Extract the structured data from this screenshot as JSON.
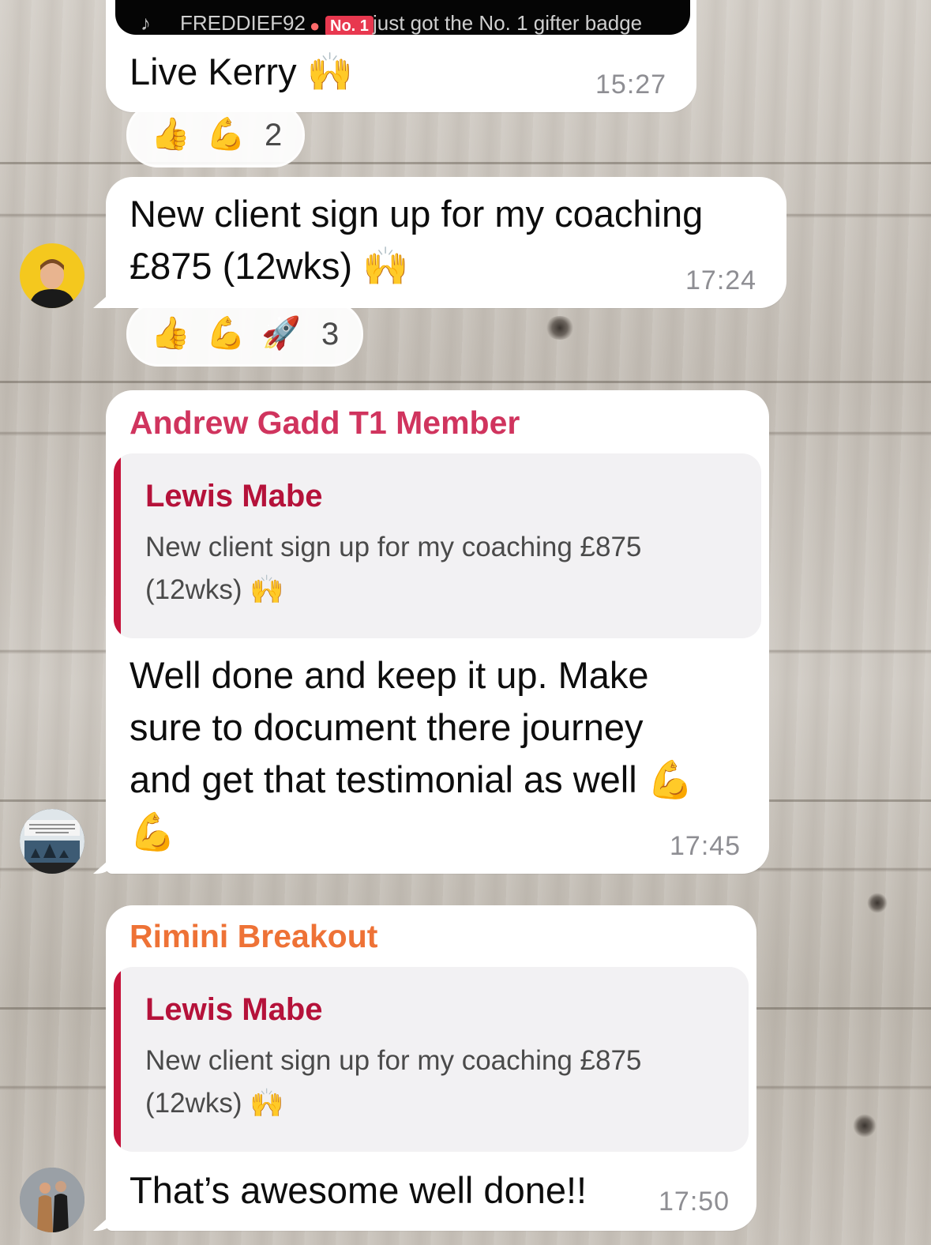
{
  "banner": {
    "username": "FREDDIEF92",
    "badge": "No. 1",
    "text": "just got the No. 1 gifter badge"
  },
  "messages": [
    {
      "text": "Live Kerry 🙌",
      "time": "15:27",
      "reactions": {
        "emojis": [
          "👍",
          "💪"
        ],
        "count": "2"
      }
    },
    {
      "line1": "New client sign up for my coaching",
      "line2": "£875 (12wks) 🙌",
      "time": "17:24",
      "reactions": {
        "emojis": [
          "👍",
          "💪",
          "🚀"
        ],
        "count": "3"
      }
    },
    {
      "sender": "Andrew Gadd T1 Member",
      "sender_color": "#d0345e",
      "quote": {
        "name": "Lewis Mabe",
        "line1": "New client sign up for my coaching £875",
        "line2": "(12wks) 🙌"
      },
      "lines": [
        "Well done and keep it up. Make",
        "sure to document there journey",
        "and get that testimonial as well 💪",
        "💪"
      ],
      "time": "17:45"
    },
    {
      "sender": "Rimini Breakout",
      "sender_color": "#ee7236",
      "quote": {
        "name": "Lewis Mabe",
        "line1": "New client sign up for my coaching £875",
        "line2": "(12wks) 🙌"
      },
      "text": "That’s awesome well done!!",
      "time": "17:50"
    }
  ],
  "colors": {
    "accent_quote": "#c5123a",
    "bubble": "#ffffff",
    "timestamp": "#8e8e93"
  }
}
